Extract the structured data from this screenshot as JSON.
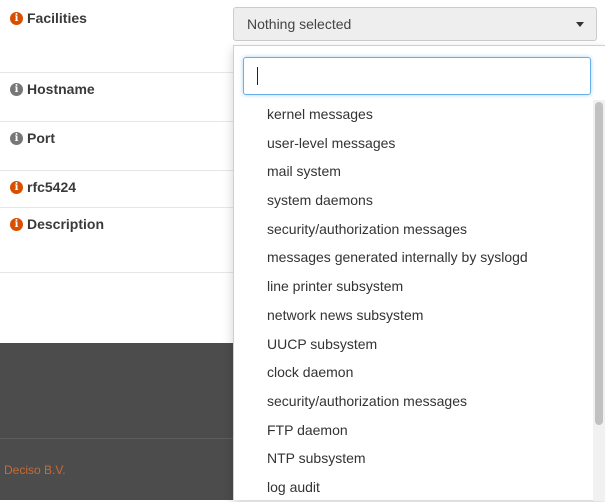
{
  "form": {
    "rows": [
      {
        "label": "Facilities",
        "icon": "info-icon",
        "icon_color": "#d94f00"
      },
      {
        "label": "Hostname",
        "icon": "info-icon",
        "icon_color": "#777777"
      },
      {
        "label": "Port",
        "icon": "info-icon",
        "icon_color": "#777777"
      },
      {
        "label": "rfc5424",
        "icon": "info-icon",
        "icon_color": "#d94f00"
      },
      {
        "label": "Description",
        "icon": "info-icon",
        "icon_color": "#d94f00"
      }
    ],
    "facilities_select": {
      "value": "Nothing selected"
    }
  },
  "dropdown": {
    "search": {
      "value": "",
      "placeholder": ""
    },
    "options": [
      "kernel messages",
      "user-level messages",
      "mail system",
      "system daemons",
      "security/authorization messages",
      "messages generated internally by syslogd",
      "line printer subsystem",
      "network news subsystem",
      "UUCP subsystem",
      "clock daemon",
      "security/authorization messages",
      "FTP daemon",
      "NTP subsystem",
      "log audit"
    ]
  },
  "footer": {
    "company": "Deciso B.V."
  },
  "colors": {
    "accent_orange": "#d94f00",
    "focus_blue": "#66afe9",
    "dark_band": "#4c4c4c"
  }
}
